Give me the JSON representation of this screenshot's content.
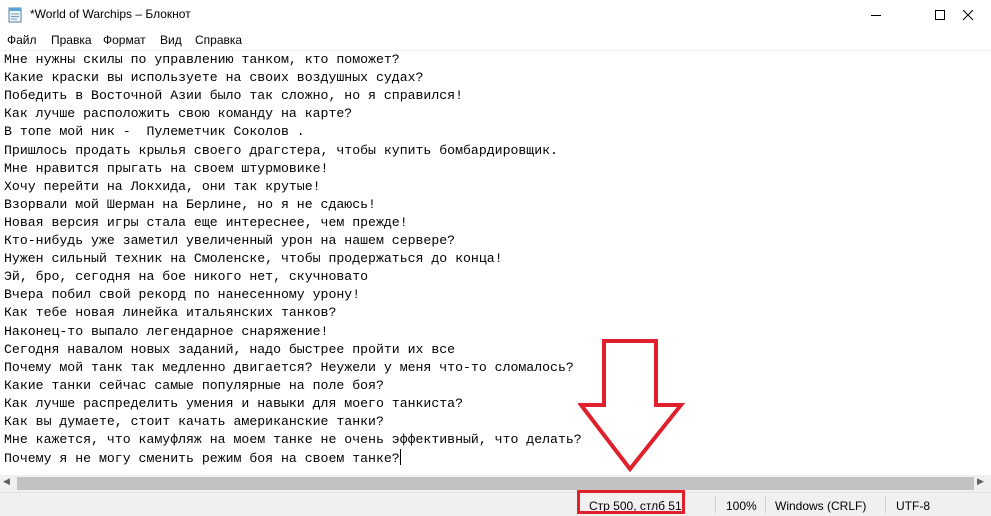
{
  "window": {
    "title": "*World of Warchips – Блокнот",
    "icons": {
      "app": "notepad-icon",
      "minimize": "minimize-icon",
      "maximize": "maximize-icon",
      "close": "close-icon"
    }
  },
  "menu": [
    "Файл",
    "Правка",
    "Формат",
    "Вид",
    "Справка"
  ],
  "editor": {
    "lines": [
      "Мне нужны скилы по управлению танком, кто поможет?",
      "Какие краски вы используете на своих воздушных судах?",
      "Победить в Восточной Азии было так сложно, но я справился!",
      "Как лучше расположить свою команду на карте?",
      "В топе мой ник -  Пулеметчик Соколов .",
      "Пришлось продать крылья своего драгстера, чтобы купить бомбардировщик.",
      "Мне нравится прыгать на своем штурмовике!",
      "Хочу перейти на Локхида, они так крутые!",
      "Взорвали мой Шерман на Берлине, но я не сдаюсь!",
      "Новая версия игры стала еще интереснее, чем прежде!",
      "Кто-нибудь уже заметил увеличенный урон на нашем сервере?",
      "Нужен сильный техник на Смоленске, чтобы продержаться до конца!",
      "Эй, бро, сегодня на бое никого нет, скучновато",
      "Вчера побил свой рекорд по нанесенному урону!",
      "Как тебе новая линейка итальянских танков?",
      "Наконец-то выпало легендарное снаряжение!",
      "Сегодня навалом новых заданий, надо быстрее пройти их все",
      "Почему мой танк так медленно двигается? Неужели у меня что-то сломалось?",
      "Какие танки сейчас самые популярные на поле боя?",
      "Как лучше распределить умения и навыки для моего танкиста?",
      "Как вы думаете, стоит качать американские танки?",
      "Мне кажется, что камуфляж на моем танке не очень эффективный, что делать?",
      "Почему я не могу сменить режим боя на своем танке?"
    ]
  },
  "scrollbar": {
    "left_arrow": "◀",
    "right_arrow": "▶"
  },
  "status": {
    "position": "Стр 500, стлб 51",
    "zoom": "100%",
    "line_endings": "Windows (CRLF)",
    "encoding": "UTF-8"
  },
  "annotation": {
    "color": "#e0202c",
    "arrow_icon": "down-arrow-icon"
  }
}
